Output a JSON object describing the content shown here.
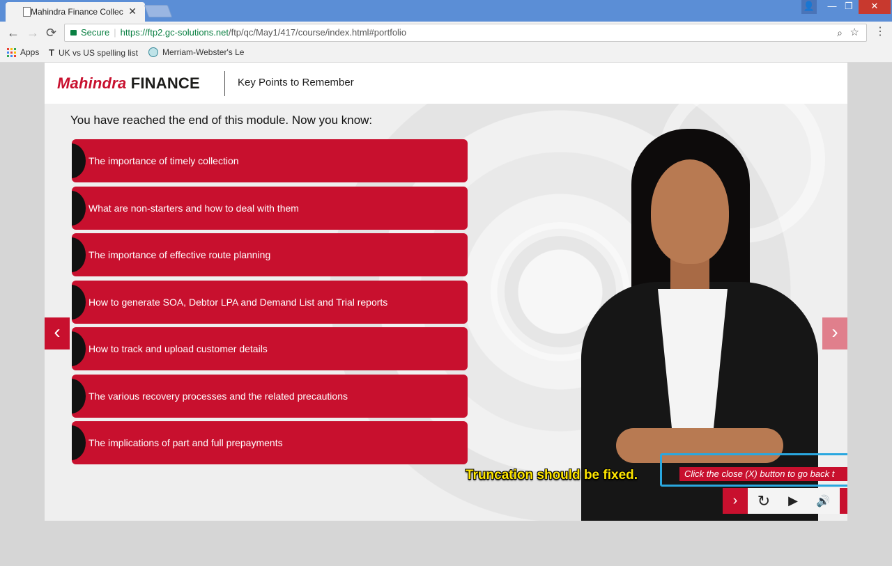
{
  "browser": {
    "tab_title": "Mahindra Finance Collec",
    "tab_close": "✕",
    "secure_label": "Secure",
    "url_main": "https://ftp2.gc-solutions.net",
    "url_rest": "/ftp/qc/May1/417/course/index.html#portfolio",
    "bookmarks": [
      {
        "label": "Apps",
        "icon": "apps-icon"
      },
      {
        "label": "UK vs US spelling list",
        "icon": "t-icon"
      },
      {
        "label": "Merriam-Webster's Le",
        "icon": "globe-icon"
      }
    ],
    "icons": {
      "back": "←",
      "forward": "→",
      "reload": "⟳",
      "zoom": "⌕",
      "star": "☆",
      "menu": "⋮",
      "minimize": "—",
      "maximize": "❐",
      "close": "✕",
      "user": "👤"
    }
  },
  "course": {
    "logo_brand": "Mahindra",
    "logo_word": "FINANCE",
    "header_title": "Key Points to Remember",
    "intro": "You have reached the end of this module. Now you know:",
    "points": [
      "The importance of timely collection",
      "What are non-starters and how to deal with them",
      "The importance of effective route planning",
      "How to generate SOA, Debtor LPA and Demand List and Trial reports",
      "How to track and upload customer details",
      "The various recovery processes and the related precautions",
      "The implications of part and full prepayments"
    ],
    "nav": {
      "prev": "‹",
      "next": "›"
    },
    "caption": "Click the close (X) button to go back t",
    "annotation": "Truncation should be fixed.",
    "controls": {
      "next": "›",
      "replay": "↻",
      "play": "▶",
      "audio": "🔊"
    }
  },
  "colors": {
    "brand_red": "#c8102e",
    "annotation_yellow": "#ffe600",
    "annotation_blue": "#2aa7df"
  }
}
